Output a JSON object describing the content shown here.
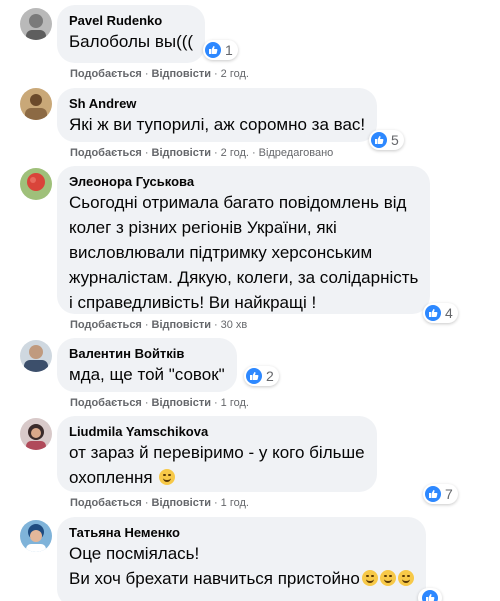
{
  "colors": {
    "bubble": "#f0f2f5",
    "like_blue": "#2d88ff",
    "meta_gray": "#65676b"
  },
  "actions": {
    "like": "Подобається",
    "reply": "Відповісти",
    "dot": "·"
  },
  "comments": [
    {
      "author": "Pavel Rudenko",
      "lines": [
        "Балоболы вы((("
      ],
      "reactions": "1",
      "time": "2 год.",
      "edited": ""
    },
    {
      "author": "Sh Andrew",
      "lines": [
        "Які ж ви тупорилі, аж соромно за вас!"
      ],
      "reactions": "5",
      "time": "2 год.",
      "edited": "Відредаговано"
    },
    {
      "author": "Элеонора Гуськова",
      "lines": [
        "Сьогодні отримала багато повідомлень від",
        "колег з різних регіонів України, які",
        "висловлювали підтримку херсонським",
        "журналістам. Дякую, колеги, за солідарність",
        "і справедливість! Ви найкращі !"
      ],
      "reactions": "4",
      "time": "30 хв",
      "edited": ""
    },
    {
      "author": "Валентин Войтків",
      "lines": [
        "мда, ще той \"совок\""
      ],
      "reactions": "2",
      "time": "1 год.",
      "edited": ""
    },
    {
      "author": "Liudmila Yamschikova",
      "lines": [
        "от зараз й перевіримо - у кого більше",
        "охоплення"
      ],
      "reactions": "7",
      "time": "1 год.",
      "edited": ""
    },
    {
      "author": "Татьяна Неменко",
      "lines": [
        "Оце посміялась!",
        "Ви хоч брехати навчиться пристойно"
      ],
      "reactions": "",
      "time": "",
      "edited": ""
    }
  ]
}
